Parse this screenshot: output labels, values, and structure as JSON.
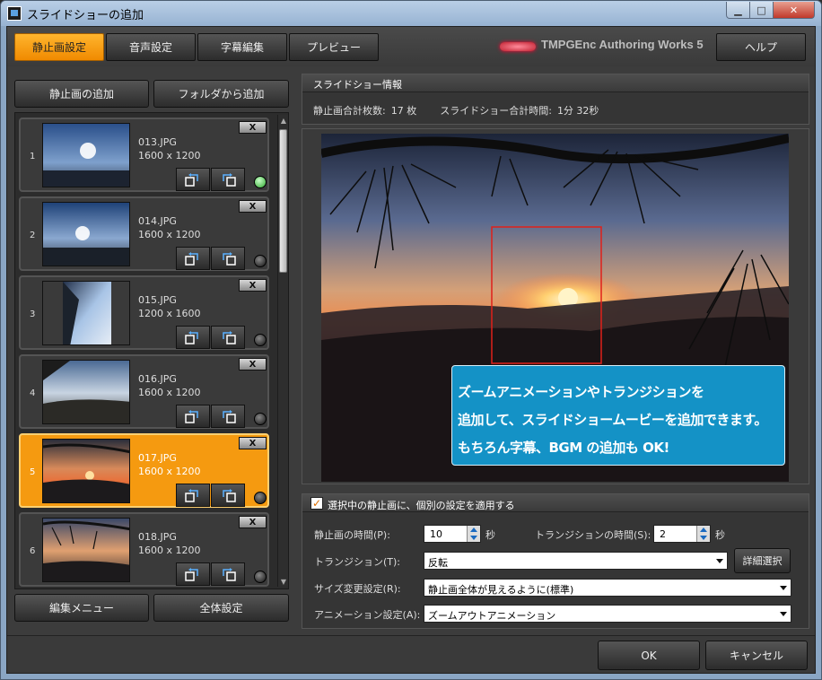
{
  "window": {
    "title": "スライドショーの追加"
  },
  "tabs": [
    {
      "label": "静止画設定",
      "active": true
    },
    {
      "label": "音声設定",
      "active": false
    },
    {
      "label": "字幕編集",
      "active": false
    },
    {
      "label": "プレビュー",
      "active": false
    }
  ],
  "brand": "TMPGEnc Authoring Works 5",
  "help_label": "ヘルプ",
  "left_panel": {
    "add_image_label": "静止画の追加",
    "add_folder_label": "フォルダから追加",
    "edit_menu_label": "編集メニュー",
    "all_settings_label": "全体設定"
  },
  "items": [
    {
      "num": "1",
      "name": "013.JPG",
      "size": "1600 x 1200",
      "selected": false,
      "status": "green",
      "delete": "X"
    },
    {
      "num": "2",
      "name": "014.JPG",
      "size": "1600 x 1200",
      "selected": false,
      "status": "dark",
      "delete": "X"
    },
    {
      "num": "3",
      "name": "015.JPG",
      "size": "1200 x 1600",
      "selected": false,
      "status": "dark",
      "delete": "X"
    },
    {
      "num": "4",
      "name": "016.JPG",
      "size": "1600 x 1200",
      "selected": false,
      "status": "dark",
      "delete": "X"
    },
    {
      "num": "5",
      "name": "017.JPG",
      "size": "1600 x 1200",
      "selected": true,
      "status": "dark",
      "delete": "X"
    },
    {
      "num": "6",
      "name": "018.JPG",
      "size": "1600 x 1200",
      "selected": false,
      "status": "dark",
      "delete": "X"
    }
  ],
  "info": {
    "header": "スライドショー情報",
    "count_label": "静止画合計枚数:",
    "count_value": "17 枚",
    "time_label": "スライドショー合計時間:",
    "time_value": "1分 32秒"
  },
  "callout": {
    "lines": [
      "ズームアニメーションやトランジションを",
      "追加して、スライドショームービーを追加できます。",
      "もちろん字幕、BGM の追加も OK!"
    ]
  },
  "settings": {
    "apply_label": "選択中の静止画に、個別の設定を適用する",
    "still_time_label": "静止画の時間(P):",
    "still_time_value": "10",
    "still_time_unit": "秒",
    "transition_time_label": "トランジションの時間(S):",
    "transition_time_value": "2",
    "transition_time_unit": "秒",
    "transition_label": "トランジション(T):",
    "transition_value": "反転",
    "detail_label": "詳細選択",
    "resize_label": "サイズ変更設定(R):",
    "resize_value": "静止画全体が見えるように(標準)",
    "animation_label": "アニメーション設定(A):",
    "animation_value": "ズームアウトアニメーション"
  },
  "footer": {
    "ok_label": "OK",
    "cancel_label": "キャンセル"
  },
  "colors": {
    "accent": "#f59a10",
    "callout": "#1492c6",
    "zoom_rect": "#e0201a"
  }
}
